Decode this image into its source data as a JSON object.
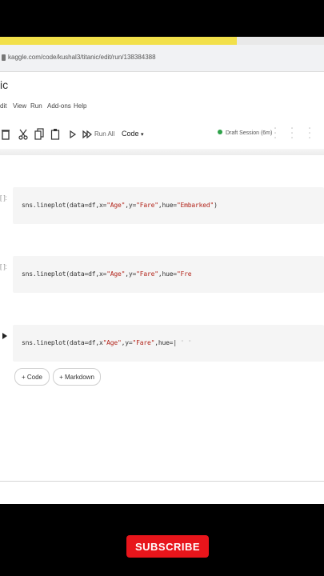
{
  "browser": {
    "url": "kaggle.com/code/kushal3/titanic/edit/run/138384388"
  },
  "notebook": {
    "title": "ic"
  },
  "menu": {
    "items": [
      "dit",
      "View",
      "Run",
      "Add-ons",
      "Help"
    ]
  },
  "toolbar": {
    "run_all": "Run All",
    "cell_type": "Code",
    "session": "Draft Session (6m)"
  },
  "cells": [
    {
      "prompt": "[ ]:",
      "code_prefix": "sns.lineplot(data=df,x=",
      "x": "\"Age\"",
      "sep1": ",y=",
      "y": "\"Fare\"",
      "sep2": ",hue=",
      "hue": "\"Embarked\"",
      "suffix": ")"
    },
    {
      "prompt": "[ ]:",
      "code_prefix": "sns.lineplot(data=df,x=",
      "x": "\"Age\"",
      "sep1": ",y=",
      "y": "\"Fare\"",
      "sep2": ",hue=",
      "hue": "\"Fre",
      "suffix": ""
    },
    {
      "prompt": "",
      "code_prefix": "sns.lineplot(data=df,x",
      "x": "\"Age\"",
      "sep1": ",y=",
      "y": "\"Fare\"",
      "sep2": ",hue=",
      "hue": "|",
      "suffix": " \" \""
    }
  ],
  "add": {
    "code": "+ Code",
    "markdown": "+ Markdown"
  },
  "overlay": {
    "subscribe": "SUBSCRIBE"
  },
  "colors": {
    "accent_yellow": "#f2e04a",
    "subscribe_red": "#e8151b",
    "session_green": "#2fa24a"
  }
}
